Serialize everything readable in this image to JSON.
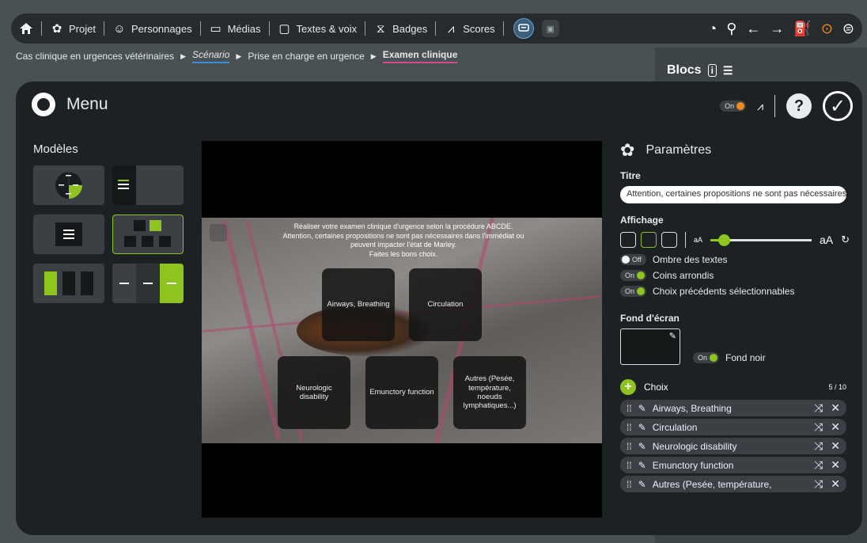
{
  "topbar": {
    "items": [
      {
        "label": "Projet",
        "icon": "gear-icon"
      },
      {
        "label": "Personnages",
        "icon": "face-icon"
      },
      {
        "label": "Médias",
        "icon": "media-icon"
      },
      {
        "label": "Textes & voix",
        "icon": "speech-icon"
      },
      {
        "label": "Badges",
        "icon": "badge-icon"
      },
      {
        "label": "Scores",
        "icon": "chart-icon"
      }
    ]
  },
  "breadcrumb": {
    "items": [
      "Cas clinique en urgences vétérinaires",
      "Scénario",
      "Prise en charge en urgence",
      "Examen clinique"
    ]
  },
  "blocs": {
    "title": "Blocs"
  },
  "modal": {
    "title": "Menu",
    "toggle_on": "On"
  },
  "models": {
    "title": "Modèles"
  },
  "preview": {
    "prompt_lines": [
      "Réaliser votre examen clinique d'urgence selon la procédure ABCDE.",
      "Attention, certaines propositions ne sont pas nécessaires dans l'immédiat ou",
      "peuvent impacter l'état de Marley.",
      "Faites les bons choix."
    ],
    "choices": [
      "Airways, Breathing",
      "Circulation",
      "Neurologic disability",
      "Emunctory function",
      "Autres (Pesée, température, noeuds lymphatiques...)"
    ]
  },
  "params": {
    "title": "Paramètres",
    "titre_label": "Titre",
    "titre_value": "Attention, certaines propositions ne sont pas nécessaires dans l'immédiat",
    "affichage_label": "Affichage",
    "size_small": "aA",
    "size_large": "aA",
    "text_size_fraction": 0.13,
    "toggles": [
      {
        "state": "Off",
        "label": "Ombre des textes"
      },
      {
        "state": "On",
        "label": "Coins arrondis"
      },
      {
        "state": "On",
        "label": "Choix précédents sélectionnables"
      }
    ],
    "fond_label": "Fond d'écran",
    "fond_noir_state": "On",
    "fond_noir_label": "Fond noir",
    "choix_label": "Choix",
    "choix_count": "5 / 10",
    "choix_items": [
      "Airways, Breathing",
      "Circulation",
      "Neurologic disability",
      "Emunctory function",
      "Autres (Pesée, température,"
    ]
  },
  "colors": {
    "accent": "#8fc31f",
    "toggle_orange": "#f08a1c",
    "bg": "#1c2124"
  }
}
